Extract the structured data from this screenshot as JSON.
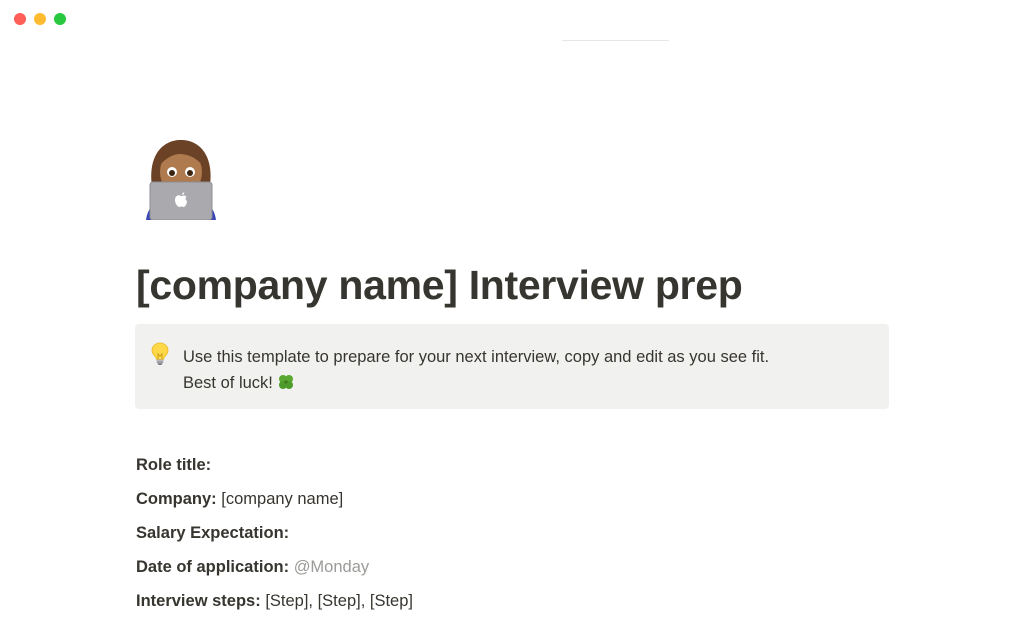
{
  "window": {
    "controls": [
      "close",
      "minimize",
      "zoom"
    ]
  },
  "page": {
    "icon": "woman-technologist-icon",
    "title": "[company name] Interview prep"
  },
  "callout": {
    "icon": "lightbulb-icon",
    "line1": "Use this template to prepare for your next interview, copy and edit as you see fit.",
    "line2": "Best of luck!",
    "line2_icon": "four-leaf-clover-icon",
    "background": "#f1f1ef"
  },
  "properties": [
    {
      "label": "Role title:",
      "value": ""
    },
    {
      "label": "Company:",
      "value": "[company name]"
    },
    {
      "label": "Salary Expectation:",
      "value": ""
    },
    {
      "label": "Date of application:",
      "value": "@Monday"
    },
    {
      "label": "Interview steps:",
      "value": "[Step], [Step], [Step]"
    }
  ],
  "colors": {
    "text": "#37352f",
    "mention": "#9b9a97",
    "close": "#ff5f57",
    "minimize": "#febc2e",
    "zoom": "#28c840"
  }
}
